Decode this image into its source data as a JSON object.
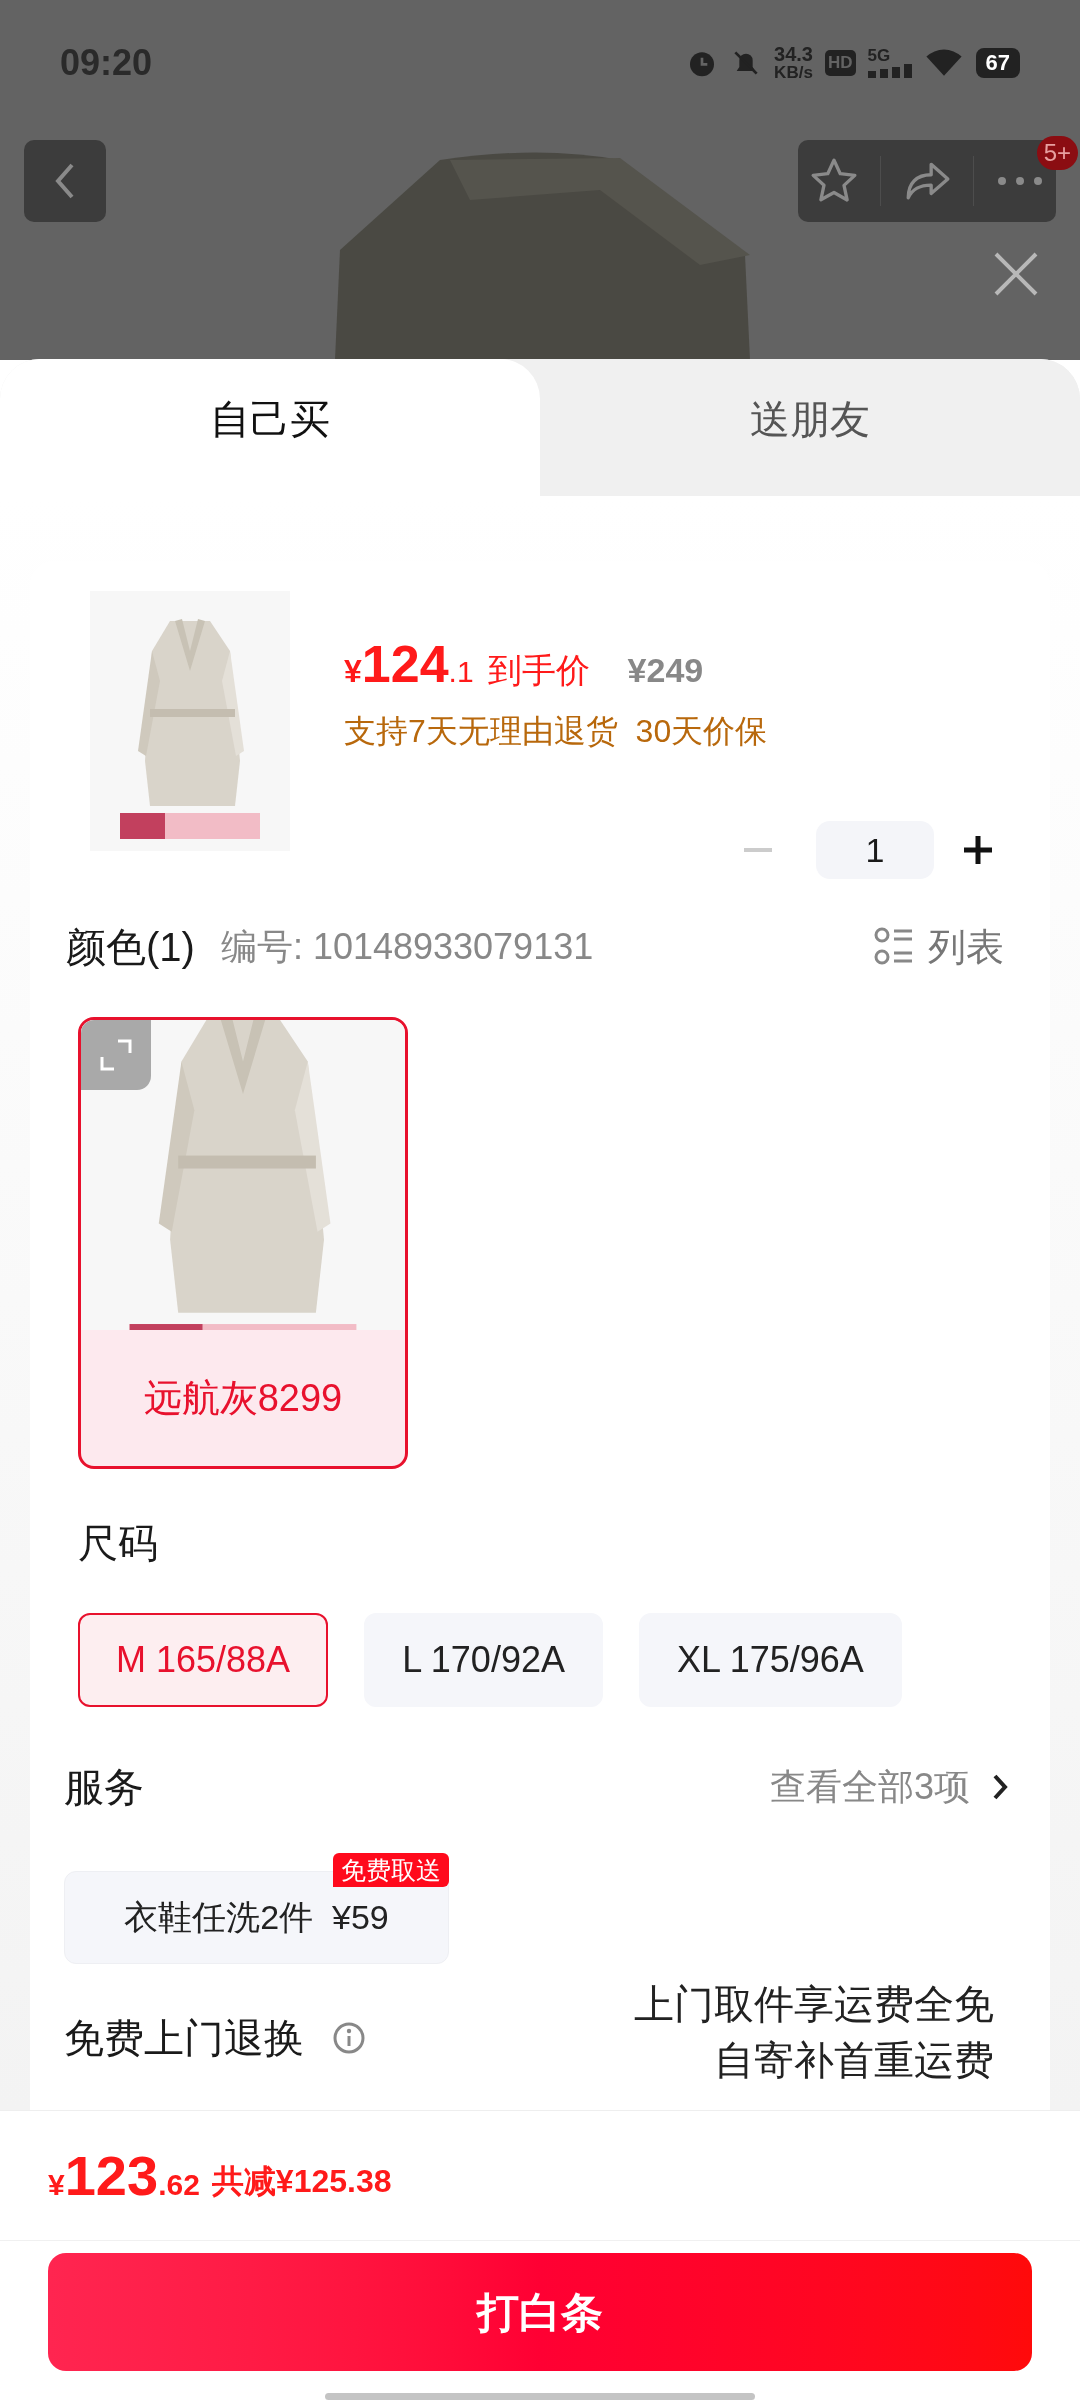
{
  "status_bar": {
    "time": "09:20",
    "net_speed": "34.3",
    "net_unit": "KB/s",
    "hd": "HD",
    "network": "5G",
    "battery": "67"
  },
  "header": {
    "badge": "5+"
  },
  "tabs": [
    {
      "label": "自己买",
      "selected": true
    },
    {
      "label": "送朋友",
      "selected": false
    }
  ],
  "product": {
    "currency": "¥",
    "price_int": "124",
    "price_dec": ".1",
    "price_label": "到手价",
    "original_price": "¥249",
    "guarantee": "支持7天无理由退货  30天价保",
    "quantity": "1",
    "decrease_disabled": true
  },
  "color_section": {
    "title": "颜色(1)",
    "sku": "编号: 10148933079131",
    "view_toggle": "列表",
    "options": [
      {
        "name": "远航灰8299",
        "selected": true
      }
    ]
  },
  "size_section": {
    "title": "尺码",
    "options": [
      {
        "label": "M 165/88A",
        "selected": true
      },
      {
        "label": "L 170/92A",
        "selected": false
      },
      {
        "label": "XL 175/96A",
        "selected": false
      }
    ]
  },
  "services": {
    "title": "服务",
    "view_all": "查看全部3项",
    "items": [
      {
        "label": "衣鞋任洗2件  ¥59",
        "tag": "免费取送"
      }
    ]
  },
  "free_return": {
    "title": "免费上门退换",
    "lines": [
      "上门取件享运费全免",
      "自寄补首重运费"
    ]
  },
  "footer": {
    "currency": "¥",
    "total_int": "123",
    "total_dec": ".62",
    "discount": "共减¥125.38",
    "button": "打白条"
  }
}
